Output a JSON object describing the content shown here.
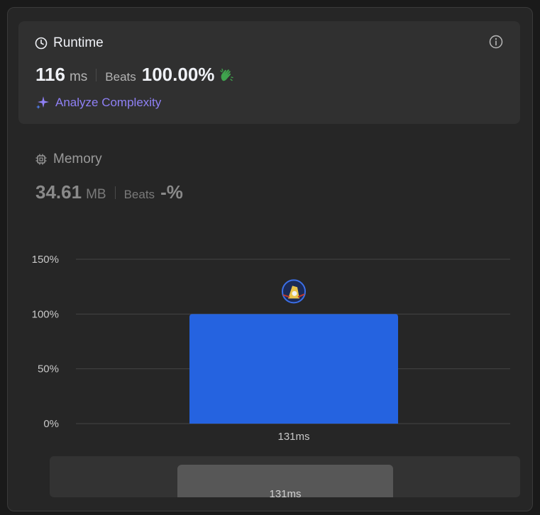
{
  "runtime": {
    "title": "Runtime",
    "value": "116",
    "unit": "ms",
    "beats_label": "Beats",
    "beats_pct": "100.00%",
    "analyze_label": "Analyze Complexity"
  },
  "memory": {
    "title": "Memory",
    "value": "34.61",
    "unit": "MB",
    "beats_label": "Beats",
    "beats_pct": "-%"
  },
  "colors": {
    "bar": "#2563e0",
    "accent_purple": "#8f80f5",
    "clap_green": "#3fa34d"
  },
  "chart_data": {
    "type": "bar",
    "categories": [
      "131ms"
    ],
    "values": [
      100
    ],
    "ylim": [
      0,
      150
    ],
    "yticks": [
      "0%",
      "50%",
      "100%",
      "150%"
    ],
    "ytick_values": [
      0,
      50,
      100,
      150
    ],
    "grid": true
  },
  "minimap": {
    "label": "131ms"
  }
}
